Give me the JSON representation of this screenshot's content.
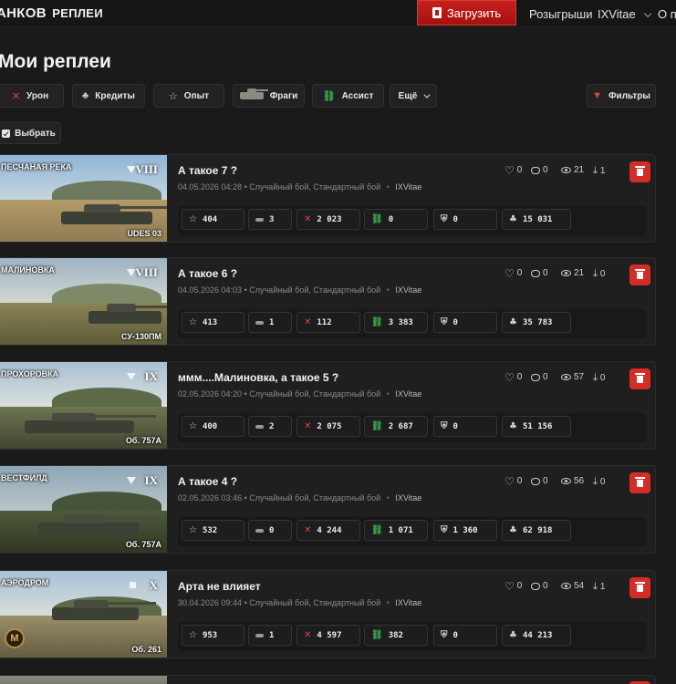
{
  "header": {
    "logo": "АНКОВ",
    "logo_sub": "РЕПЛЕИ",
    "upload_label": "Загрузить",
    "giveaways_label": "Розыгрыши",
    "user_label": "IXVitae",
    "about_label": "О п"
  },
  "page_title": "Мои реплеи",
  "filters": {
    "damage": "Урон",
    "credits": "Кредиты",
    "exp": "Опыт",
    "frags": "Фраги",
    "assist": "Ассист",
    "more": "Ещё",
    "filters_btn": "Фильтры"
  },
  "select_label": "Выбрать",
  "colors": {
    "accent_red": "#d52c26",
    "assist_green": "#36a24a"
  },
  "replays": [
    {
      "title": "А такое 7 ?",
      "date": "04.05.2026 04:28",
      "mode": "• Случайный бой, Стандартный бой",
      "bullet": "•",
      "author": "IXVitae",
      "map": "ПЕСЧАНАЯ РЕКА",
      "tier": "VIII",
      "tank": "UDES 03",
      "likes": "0",
      "comments": "0",
      "views": "21",
      "downloads": "1",
      "stats": {
        "exp": "404",
        "frags_spotted": "3",
        "damage": "2 023",
        "assist": "0",
        "blocked": "0",
        "credits": "15 031"
      }
    },
    {
      "title": "А такое 6 ?",
      "date": "04.05.2026 04:03",
      "mode": "• Случайный бой, Стандартный бой",
      "bullet": "•",
      "author": "IXVitae",
      "map": "МАЛИНОВКА",
      "tier": "VIII",
      "tank": "СУ-130ПМ",
      "likes": "0",
      "comments": "0",
      "views": "21",
      "downloads": "0",
      "stats": {
        "exp": "413",
        "frags_spotted": "1",
        "damage": "112",
        "assist": "3 383",
        "blocked": "0",
        "credits": "35 783"
      }
    },
    {
      "title": "ммм....Малиновка, а такое 5 ?",
      "date": "02.05.2026 04:20",
      "mode": "• Случайный бой, Стандартный бой",
      "bullet": "•",
      "author": "IXVitae",
      "map": "ПРОХОРОВКА",
      "tier": "IX",
      "tank": "Об. 757А",
      "likes": "0",
      "comments": "0",
      "views": "57",
      "downloads": "0",
      "stats": {
        "exp": "400",
        "frags_spotted": "2",
        "damage": "2 075",
        "assist": "2 687",
        "blocked": "0",
        "credits": "51 156"
      }
    },
    {
      "title": "А такое 4 ?",
      "date": "02.05.2026 03:46",
      "mode": "• Случайный бой, Стандартный бой",
      "bullet": "•",
      "author": "IXVitae",
      "map": "ВЕСТФИЛД",
      "tier": "IX",
      "tank": "Об. 757А",
      "likes": "0",
      "comments": "0",
      "views": "56",
      "downloads": "0",
      "stats": {
        "exp": "532",
        "frags_spotted": "0",
        "damage": "4 244",
        "assist": "1 071",
        "blocked": "1 360",
        "credits": "62 918"
      }
    },
    {
      "title": "Арта не влияет",
      "date": "30.04.2026 09:44",
      "mode": "• Случайный бой, Стандартный бой",
      "bullet": "•",
      "author": "IXVitae",
      "map": "АЭРОДРОМ",
      "tier": "X",
      "tank": "Об. 261",
      "mastery": "M",
      "likes": "0",
      "comments": "0",
      "views": "54",
      "downloads": "1",
      "stats": {
        "exp": "953",
        "frags_spotted": "1",
        "damage": "4 597",
        "assist": "382",
        "blocked": "0",
        "credits": "44 213"
      }
    }
  ]
}
